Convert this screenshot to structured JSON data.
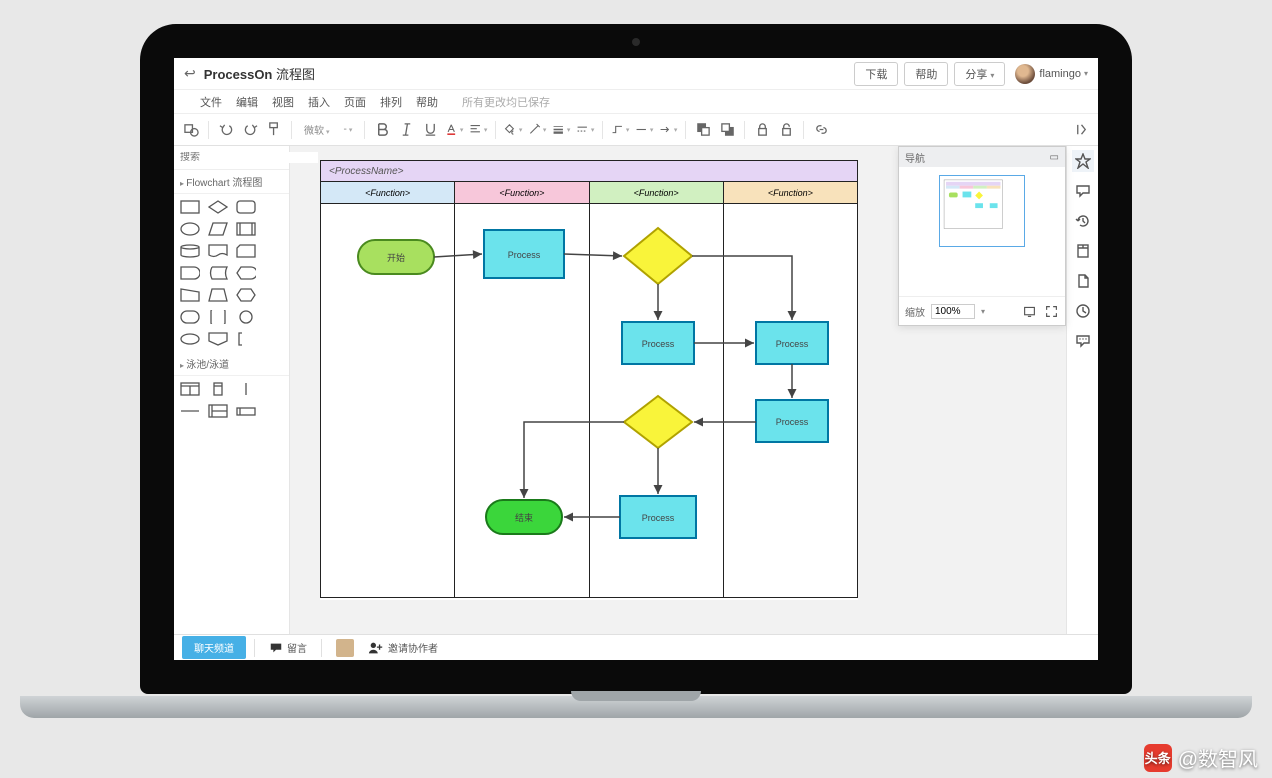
{
  "header": {
    "brand": "ProcessOn",
    "doc_title": "流程图",
    "download": "下载",
    "help": "帮助",
    "share": "分享",
    "username": "flamingo"
  },
  "menu": {
    "file": "文件",
    "edit": "编辑",
    "view": "视图",
    "insert": "插入",
    "page": "页面",
    "arrange": "排列",
    "help": "帮助",
    "hint": "所有更改均已保存"
  },
  "toolbar": {
    "font": "微软",
    "size": "-",
    "fill_label": "填",
    "line_label": "线"
  },
  "left": {
    "search_ph": "搜索",
    "cat_flow": "Flowchart 流程图",
    "cat_lane": "泳池/泳道"
  },
  "diagram": {
    "title": "<ProcessName>",
    "lanes": [
      "<Function>",
      "<Function>",
      "<Function>",
      "<Function>"
    ],
    "nodes": {
      "start": "开始",
      "p1": "Process",
      "p2": "Process",
      "p3": "Process",
      "p4": "Process",
      "p5": "Process",
      "end": "结束"
    }
  },
  "nav": {
    "title": "导航",
    "zoom_label": "缩放",
    "zoom_value": "100%"
  },
  "footer": {
    "chat_tag": "聊天频道",
    "comment": "留言",
    "invite": "邀请协作者"
  },
  "watermark": {
    "logo": "头条",
    "handle": "@数智风"
  }
}
